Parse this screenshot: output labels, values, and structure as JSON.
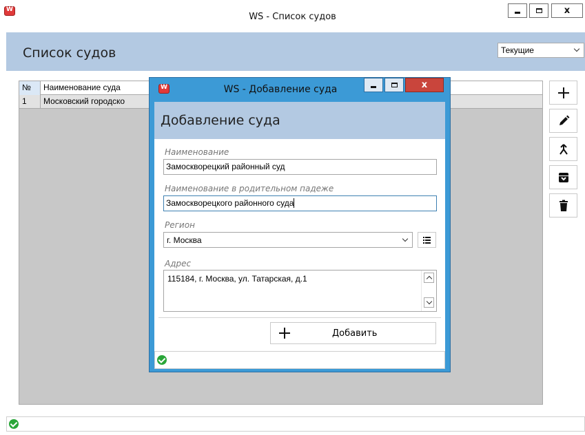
{
  "main_window": {
    "title": "WS - Список судов",
    "header_title": "Список судов",
    "filter": {
      "value": "Текущие"
    },
    "grid": {
      "columns": [
        "№",
        "Наименование суда"
      ],
      "rows": [
        {
          "num": "1",
          "name": "Московский городско"
        }
      ]
    },
    "toolbar": {
      "icons": [
        "plus-icon",
        "pencil-icon",
        "merge-icon",
        "archive-icon",
        "trash-icon"
      ]
    },
    "status": {
      "icon": "check-circle-icon",
      "color": "#2aa639"
    }
  },
  "dialog": {
    "title": "WS - Добавление суда",
    "header_title": "Добавление суда",
    "fields": {
      "name": {
        "label": "Наименование",
        "value": "Замоскворецкий районный суд"
      },
      "genitive": {
        "label": "Наименование в родительном падеже",
        "value": "Замоскворецкого районного суда"
      },
      "region": {
        "label": "Регион",
        "value": "г. Москва"
      },
      "address": {
        "label": "Адрес",
        "value": "115184, г. Москва, ул. Татарская, д.1"
      }
    },
    "add_button": {
      "label": "Добавить"
    },
    "status": {
      "icon": "check-circle-icon"
    }
  },
  "colors": {
    "header_band": "#b3c9e2",
    "dialog_frame": "#3c9ad6",
    "close_button": "#c9453c",
    "grid_background": "#c8c8c8"
  }
}
